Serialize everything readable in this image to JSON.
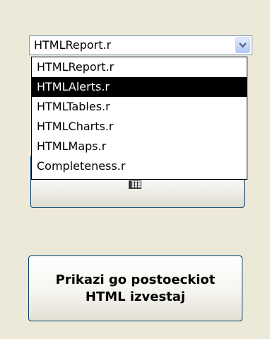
{
  "report_select": {
    "value": "HTMLReport.r",
    "arrow_icon": "chevron-down-icon",
    "options": [
      {
        "label": "HTMLReport.r",
        "selected": false
      },
      {
        "label": "HTMLAlerts.r",
        "selected": true
      },
      {
        "label": "HTMLTables.r",
        "selected": false
      },
      {
        "label": "HTMLCharts.r",
        "selected": false
      },
      {
        "label": "HTMLMaps.r",
        "selected": false
      },
      {
        "label": "Completeness.r",
        "selected": false
      }
    ]
  },
  "hidden_button": {
    "icon": "table-grid-icon"
  },
  "show_report_button": {
    "label": "Prikazi go postoeckiot HTML izvestaj"
  },
  "colors": {
    "window_background": "#ECE9D8",
    "selection_background": "#000000",
    "selection_text": "#FFFFFF",
    "button_border": "#003C74",
    "combo_border": "#7F9DB9"
  }
}
